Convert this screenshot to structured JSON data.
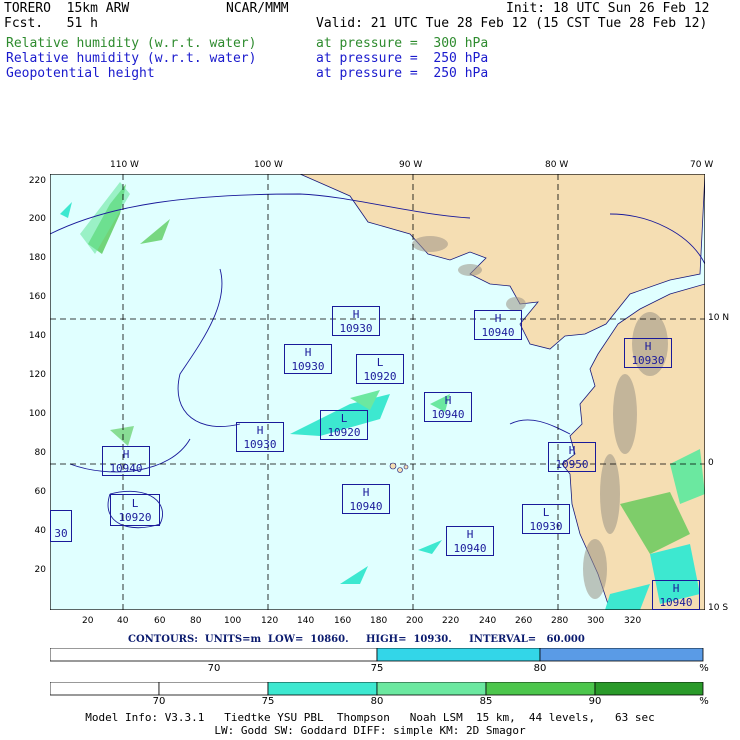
{
  "header": {
    "model": "TORERO  15km ARW",
    "org": "NCAR/MMM",
    "init": "Init: 18 UTC Sun 26 Feb 12",
    "fcst": "Fcst.   51 h",
    "valid": "Valid: 21 UTC Tue 28 Feb 12 (15 CST Tue 28 Feb 12)",
    "fields": [
      {
        "name": "Relative humidity (w.r.t. water)",
        "level": "at pressure =  300 hPa",
        "color": "#2e8b2e"
      },
      {
        "name": "Relative humidity (w.r.t. water)",
        "level": "at pressure =  250 hPa",
        "color": "#1a1acd"
      },
      {
        "name": "Geopotential height",
        "level": "at pressure =  250 hPa",
        "color": "#1a1acd"
      }
    ]
  },
  "map": {
    "lon_labels": [
      "110 W",
      "100 W",
      "90 W",
      "80 W",
      "70 W"
    ],
    "lat_labels": [
      "10 N",
      "0",
      "10 S"
    ],
    "y_ticks": [
      "220",
      "200",
      "180",
      "160",
      "140",
      "120",
      "100",
      "80",
      "60",
      "40",
      "20"
    ],
    "x_ticks": [
      "20",
      "40",
      "60",
      "80",
      "100",
      "120",
      "140",
      "160",
      "180",
      "200",
      "220",
      "240",
      "260",
      "280",
      "300",
      "320"
    ],
    "centers": [
      {
        "type": "H",
        "value": "10930"
      },
      {
        "type": "H",
        "value": "10940"
      },
      {
        "type": "H",
        "value": "10930"
      },
      {
        "type": "L",
        "value": "10920"
      },
      {
        "type": "H",
        "value": "10930"
      },
      {
        "type": "H",
        "value": "10940"
      },
      {
        "type": "L",
        "value": "10920"
      },
      {
        "type": "H",
        "value": "10930"
      },
      {
        "type": "H",
        "value": "10950"
      },
      {
        "type": "H",
        "value": "10940"
      },
      {
        "type": "L",
        "value": "10920"
      },
      {
        "type": "H",
        "value": "10940"
      },
      {
        "type": "L",
        "value": "10930"
      },
      {
        "type": "H",
        "value": "10940"
      },
      {
        "type": "H",
        "value": "10940"
      },
      {
        "type": "",
        "value": "30"
      }
    ],
    "colors": {
      "ocean": "#e0ffff",
      "land": "#f5deb3",
      "mountain": "#9c9486",
      "grid": "#000000",
      "coast": "#1a1a7a"
    }
  },
  "contours": "CONTOURS:  UNITS=m  LOW=  10860.     HIGH=  10930.     INTERVAL=   60.000",
  "bar1": {
    "labels": [
      "70",
      "75",
      "80"
    ],
    "unit": "%",
    "segments": [
      {
        "from": 0,
        "to": 50,
        "color": "#ffffff"
      },
      {
        "from": 50,
        "to": 75,
        "color": "#33d6e8"
      },
      {
        "from": 75,
        "to": 100,
        "color": "#5a9be6"
      }
    ]
  },
  "bar2": {
    "labels": [
      "70",
      "75",
      "80",
      "85",
      "90"
    ],
    "unit": "%",
    "segments": [
      {
        "from": 0,
        "to": 16.5,
        "color": "#ffffff"
      },
      {
        "from": 16.5,
        "to": 33.5,
        "color": "#ffffff"
      },
      {
        "from": 33.5,
        "to": 50,
        "color": "#3de8d0"
      },
      {
        "from": 50,
        "to": 66.5,
        "color": "#6be8a0"
      },
      {
        "from": 66.5,
        "to": 83.5,
        "color": "#4cc64c"
      },
      {
        "from": 83.5,
        "to": 100,
        "color": "#2a9a2a"
      }
    ]
  },
  "footer": {
    "line1": "Model Info: V3.3.1   Tiedtke YSU PBL  Thompson   Noah LSM  15 km,  44 levels,   63 sec",
    "line2": "LW: Godd SW: Goddard DIFF: simple KM: 2D Smagor"
  }
}
